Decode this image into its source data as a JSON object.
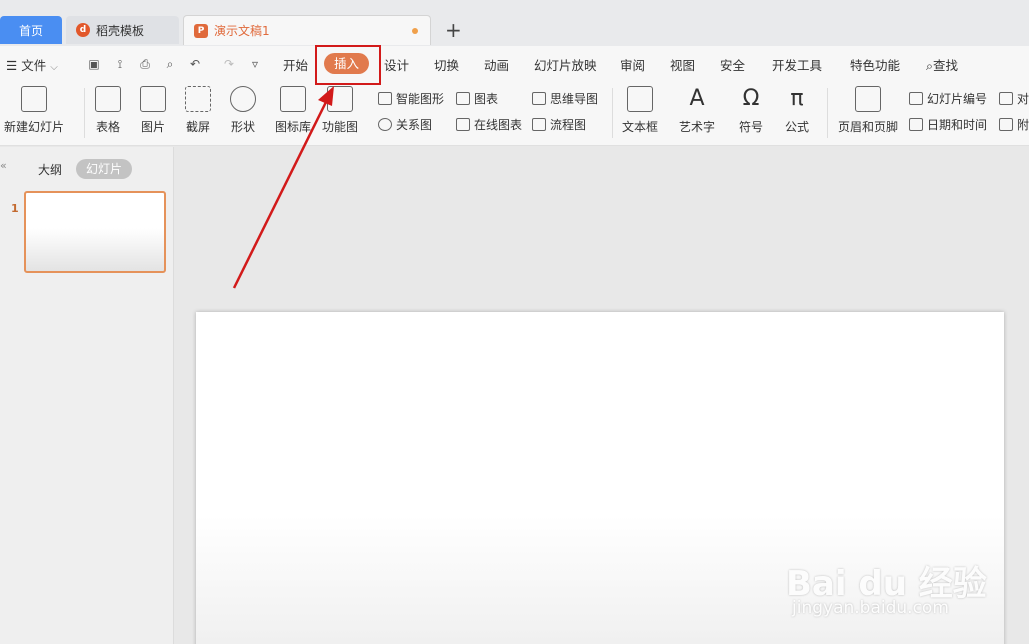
{
  "tabs": {
    "home": "首页",
    "template": "稻壳模板",
    "document": "演示文稿1",
    "new_tab": "+"
  },
  "menu": {
    "file": "文件",
    "items": [
      "开始",
      "插入",
      "设计",
      "切换",
      "动画",
      "幻灯片放映",
      "审阅",
      "视图",
      "安全",
      "开发工具",
      "特色功能"
    ],
    "search": "查找"
  },
  "ribbon": {
    "new_slide": "新建幻灯片",
    "table": "表格",
    "picture": "图片",
    "screenshot": "截屏",
    "shape": "形状",
    "icon_lib": "图标库",
    "function_chart": "功能图",
    "smart_shape": "智能图形",
    "chart": "图表",
    "relation_chart": "关系图",
    "online_chart": "在线图表",
    "mind_map": "思维导图",
    "flowchart": "流程图",
    "textbox": "文本框",
    "wordart": "艺术字",
    "symbol": "符号",
    "formula": "公式",
    "header_footer": "页眉和页脚",
    "slide_number": "幻灯片编号",
    "date_time": "日期和时间",
    "object": "对",
    "attachment": "附"
  },
  "sidebar": {
    "outline": "大纲",
    "slides": "幻灯片",
    "slide_number": "1"
  },
  "watermark": {
    "main": "Bai du 经验",
    "sub": "jingyan.baidu.com"
  },
  "colors": {
    "accent": "#e17a4d",
    "home_tab": "#4a8ef2",
    "annotation": "#d21a1a"
  }
}
